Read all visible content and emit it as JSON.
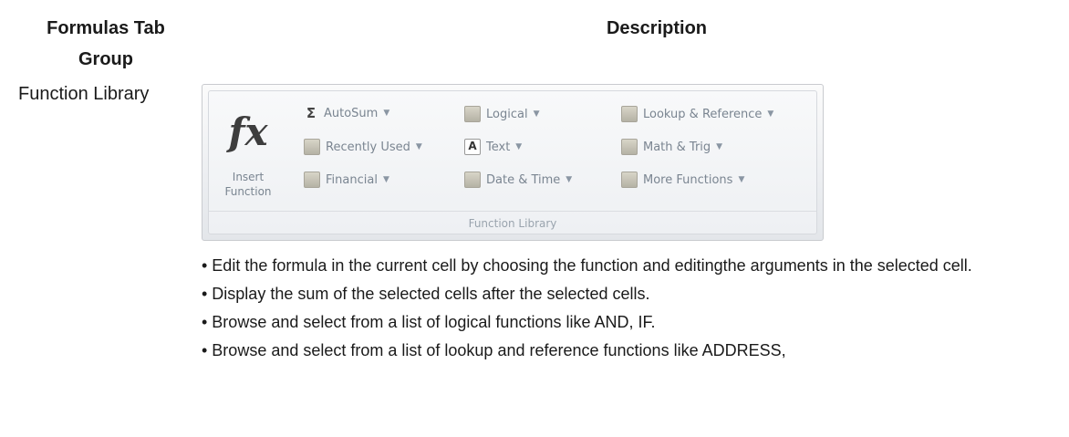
{
  "table": {
    "header_group": "Formulas Tab Group",
    "header_group_line1": "Formulas Tab",
    "header_group_line2": "Group",
    "header_description": "Description",
    "row_label": "Function Library"
  },
  "ribbon": {
    "insert_function_line1": "Insert",
    "insert_function_line2": "Function",
    "items": [
      {
        "label": "AutoSum",
        "icon": "sigma-icon"
      },
      {
        "label": "Recently Used",
        "icon": "recently-used-icon"
      },
      {
        "label": "Financial",
        "icon": "financial-icon"
      },
      {
        "label": "Logical",
        "icon": "logical-icon"
      },
      {
        "label": "Text",
        "icon": "text-icon"
      },
      {
        "label": "Date & Time",
        "icon": "date-time-icon"
      },
      {
        "label": "Lookup & Reference",
        "icon": "lookup-reference-icon"
      },
      {
        "label": "Math & Trig",
        "icon": "math-trig-icon"
      },
      {
        "label": "More Functions",
        "icon": "more-functions-icon"
      }
    ],
    "group_label": "Function Library"
  },
  "bullets": [
    "• Edit the formula in the current cell by choosing the function and editingthe arguments in the selected cell.",
    "• Display the sum of the selected cells after the selected cells.",
    "• Browse and select from a list of logical functions like AND, IF.",
    "• Browse and select from a list of lookup and reference functions like ADDRESS,"
  ]
}
